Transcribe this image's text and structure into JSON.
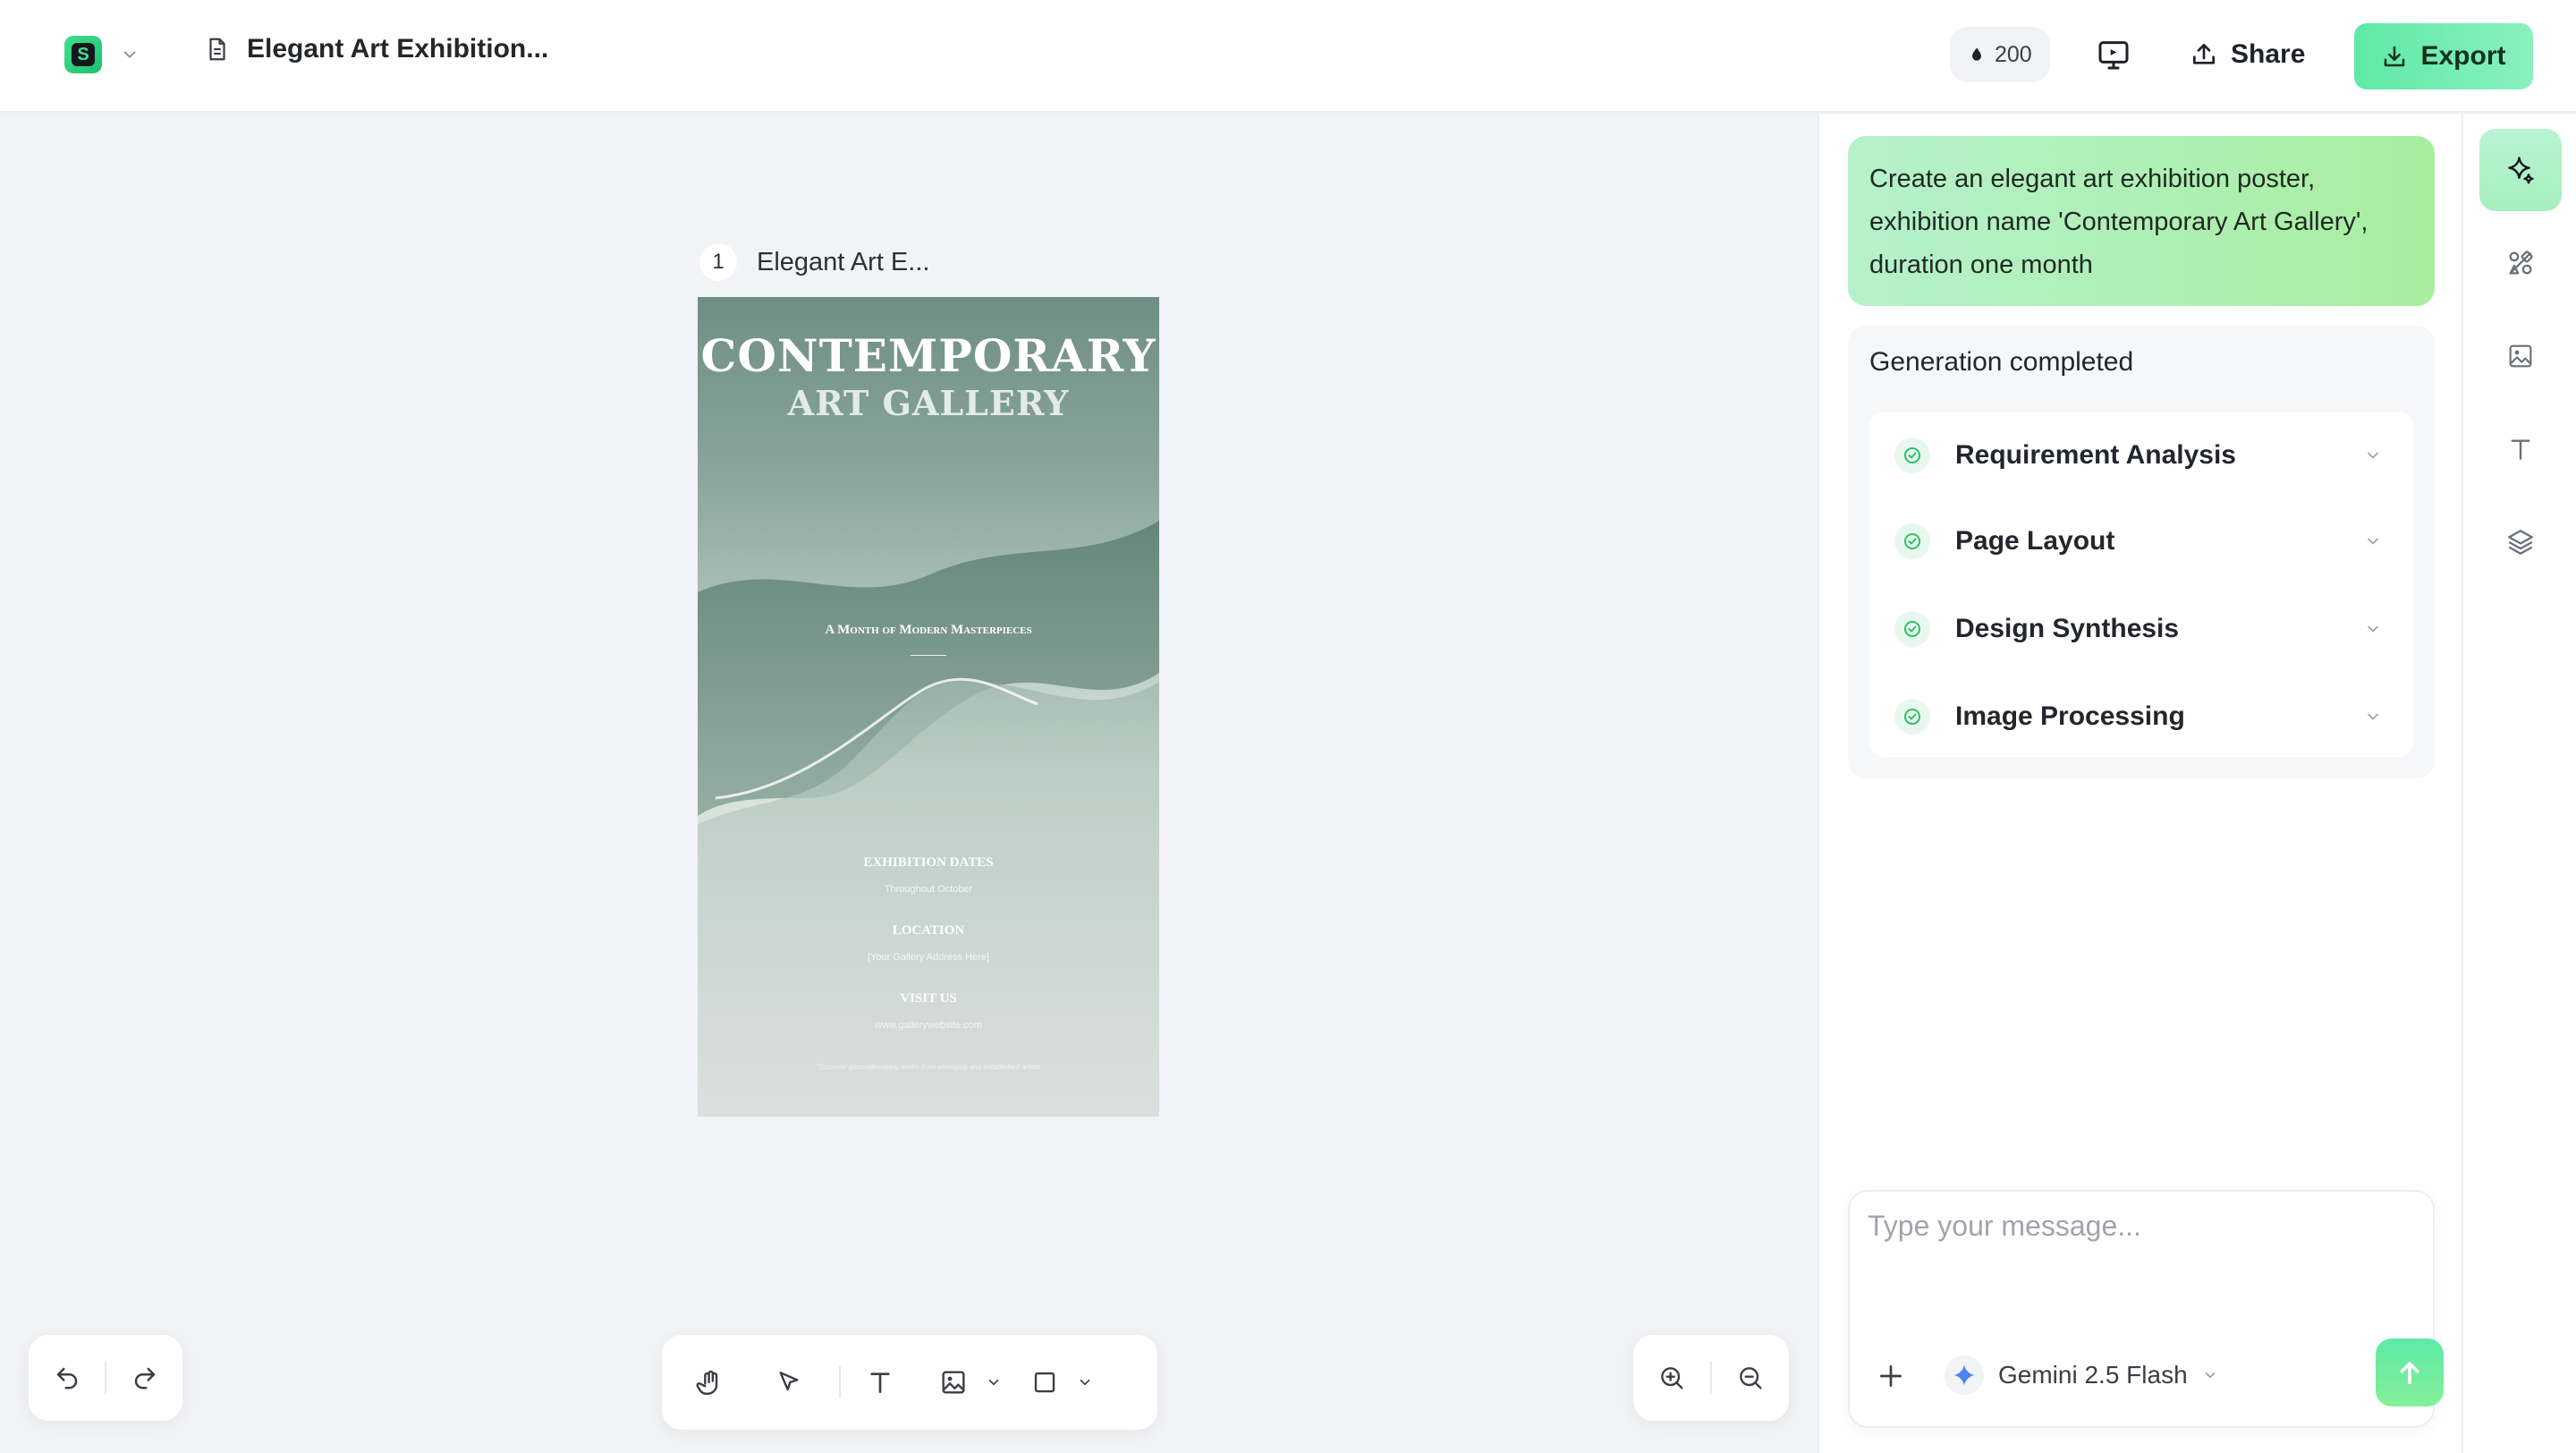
{
  "header": {
    "app_logo": "logo-icon",
    "doc_title": "Elegant Art Exhibition...",
    "credits": "200",
    "share_label": "Share",
    "export_label": "Export"
  },
  "canvas": {
    "page_number": "1",
    "page_name": "Elegant Art E...",
    "poster": {
      "title_line1": "CONTEMPORARY",
      "title_line2": "ART GALLERY",
      "tagline": "A Month of Modern Masterpieces",
      "dates_heading": "EXHIBITION DATES",
      "dates_value": "Throughout October",
      "location_heading": "LOCATION",
      "location_value": "[Your Gallery Address Here]",
      "visit_heading": "VISIT US",
      "visit_value": "www.gallerywebsite.com",
      "footnote": "*Discover groundbreaking works from emerging and established artists"
    }
  },
  "chat": {
    "prompt": "Create an elegant art exhibition poster, exhibition name 'Contemporary Art Gallery', duration one month",
    "status": "Generation completed",
    "steps": [
      {
        "label": "Requirement Analysis"
      },
      {
        "label": "Page Layout"
      },
      {
        "label": "Design Synthesis"
      },
      {
        "label": "Image Processing"
      }
    ],
    "input_placeholder": "Type your message...",
    "model": "Gemini 2.5 Flash"
  },
  "colors": {
    "accent": "#5ee9a7",
    "prompt_bubble": "#b6f1cc",
    "check_green": "#2fbf6a"
  }
}
